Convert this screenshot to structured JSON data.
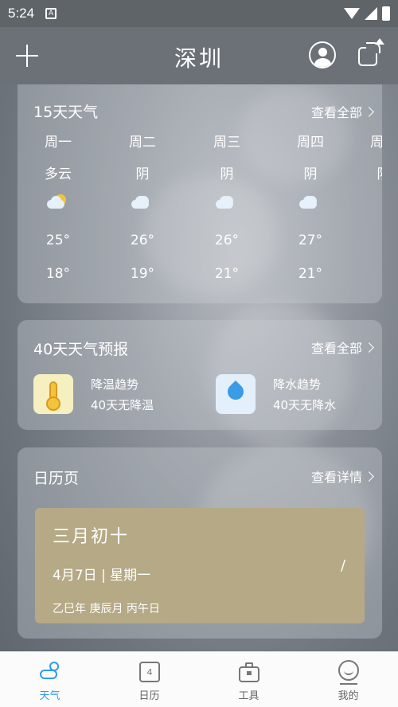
{
  "status_bar": {
    "time": "5:24",
    "notif_glyph": "A"
  },
  "header": {
    "city": "深圳",
    "add_icon": "plus-icon",
    "user_icon": "user-icon",
    "share_icon": "share-icon"
  },
  "forecast15": {
    "title": "15天天气",
    "view_all": "查看全部",
    "days": [
      {
        "weekday": "周一",
        "condition": "多云",
        "icon": "partly-cloudy-icon",
        "high": "25°",
        "low": "18°"
      },
      {
        "weekday": "周二",
        "condition": "阴",
        "icon": "overcast-icon",
        "high": "26°",
        "low": "19°"
      },
      {
        "weekday": "周三",
        "condition": "阴",
        "icon": "overcast-icon",
        "high": "26°",
        "low": "21°"
      },
      {
        "weekday": "周四",
        "condition": "阴",
        "icon": "overcast-icon",
        "high": "27°",
        "low": "21°"
      },
      {
        "weekday": "周五",
        "condition": "阴",
        "icon": "overcast-icon",
        "high": "",
        "low": ""
      }
    ]
  },
  "forecast40": {
    "title": "40天天气预报",
    "view_all": "查看全部",
    "temp_trend": {
      "label": "降温趋势",
      "value": "40天无降温",
      "icon": "thermometer-icon",
      "color": "#f6efbf"
    },
    "rain_trend": {
      "label": "降水趋势",
      "value": "40天无降水",
      "icon": "raindrop-icon",
      "color": "#e3f0fb"
    }
  },
  "calendar": {
    "title": "日历页",
    "view_detail": "查看详情",
    "lunar_date": "三月初十",
    "date": "4月7日 | 星期一",
    "slash": "/",
    "ganzhi": "乙巳年 庚辰月 丙午日"
  },
  "bottom_nav": {
    "items": [
      {
        "label": "天气",
        "icon": "weather-icon",
        "active": true
      },
      {
        "label": "日历",
        "icon": "calendar-icon",
        "active": false,
        "icon_text": "4"
      },
      {
        "label": "工具",
        "icon": "toolbox-icon",
        "active": false
      },
      {
        "label": "我的",
        "icon": "profile-icon",
        "active": false
      }
    ]
  },
  "colors": {
    "accent": "#2f9cf0",
    "calendar_bg": "#b5a986"
  }
}
